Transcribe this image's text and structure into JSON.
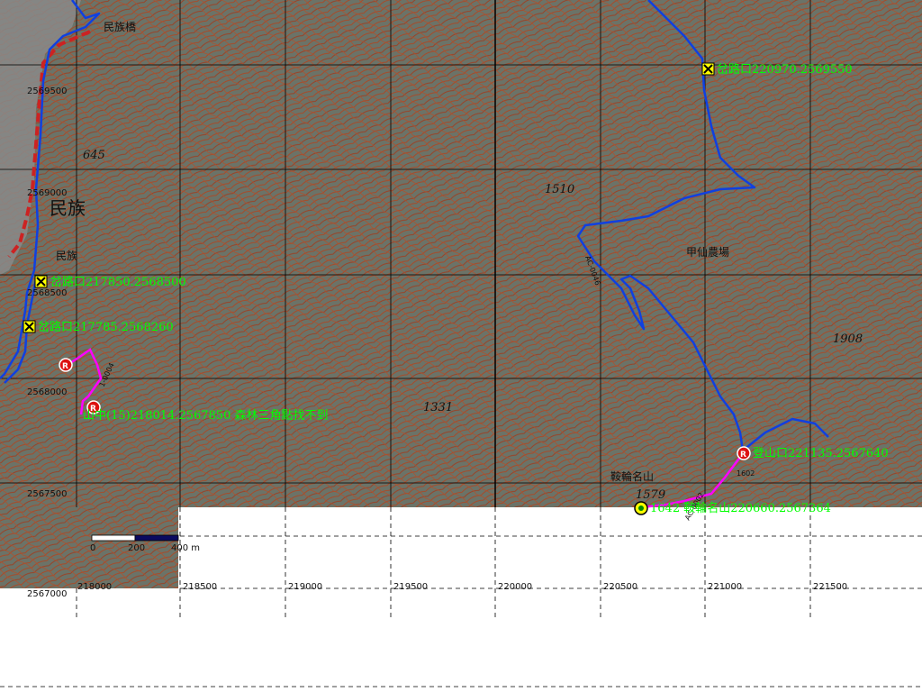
{
  "map": {
    "place_labels": {
      "minzu_bridge": "民族橋",
      "minzu_large": "民族",
      "minzu_small": "民族",
      "jiaxian_farm": "甲仙農場",
      "leilun_mountain": "鞍輪名山"
    },
    "elevations": {
      "e645": "645",
      "e1510": "1510",
      "e1908": "1908",
      "e1331": "1331",
      "e1579": "1579",
      "e1602": "1602"
    },
    "waypoints": {
      "junction_top_right": "岔路口220970.2569550",
      "junction_left_1": "岔路口217850.2568500",
      "junction_left_2": "岔路口217785.2568260",
      "trailhead": "登山口221135.2567640",
      "summit": "1642 鞍輪名山220660.2567364",
      "triangulation": "山中(15)218014.2567850 森林三角點找不到"
    },
    "coords": {
      "x_labels": [
        "218000",
        "218500",
        "219000",
        "219500",
        "220000",
        "220500",
        "221000",
        "221500"
      ],
      "y_labels": [
        "2569500",
        "2569000",
        "2568500",
        "2568000",
        "2567500",
        "2567000"
      ]
    },
    "scale_bar": {
      "ticks": [
        "0",
        "200",
        "400 m"
      ]
    },
    "trail_codes": {
      "code1": "AC-0046",
      "code2": "AC-0002",
      "code3": "1-0004"
    },
    "colors": {
      "terrain": "#6b7368",
      "contour": "#a84a28",
      "route": "#1040e0",
      "track": "#ff00ff",
      "road": "#cc2222",
      "waypoint_text": "#00ff00",
      "grid": "#000000"
    },
    "icons": {
      "junction_marker": "junction-x-icon",
      "trail_marker": "trailhead-r-icon",
      "summit_marker": "summit-target-icon"
    }
  }
}
